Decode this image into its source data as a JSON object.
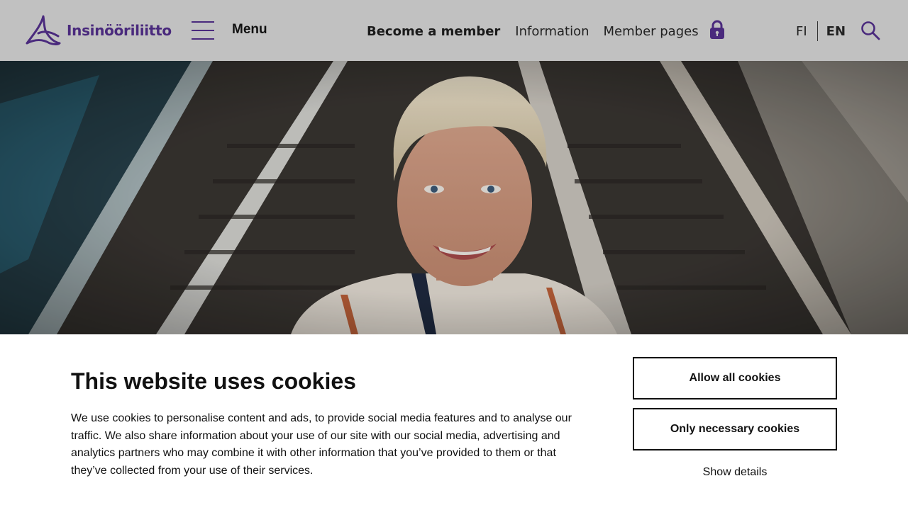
{
  "header": {
    "logo_text": "Insinööriliitto",
    "menu_label": "Menu",
    "nav": {
      "become_member": "Become a member",
      "information": "Information",
      "member_pages": "Member pages"
    },
    "lang": {
      "fi": "FI",
      "en": "EN"
    }
  },
  "colors": {
    "brand": "#4a2a7d",
    "header_bg": "#c1c1c1"
  },
  "icons": [
    "logo-mark-icon",
    "hamburger-icon",
    "lock-icon",
    "search-icon"
  ],
  "cookie": {
    "title": "This website uses cookies",
    "body": "We use cookies to personalise content and ads, to provide social media features and to analyse our traffic. We also share information about your use of our site with our social media, advertising and analytics partners who may combine it with other information that you’ve provided to them or that they’ve collected from your use of their services.",
    "allow_all": "Allow all cookies",
    "only_necessary": "Only necessary cookies",
    "show_details": "Show details"
  }
}
